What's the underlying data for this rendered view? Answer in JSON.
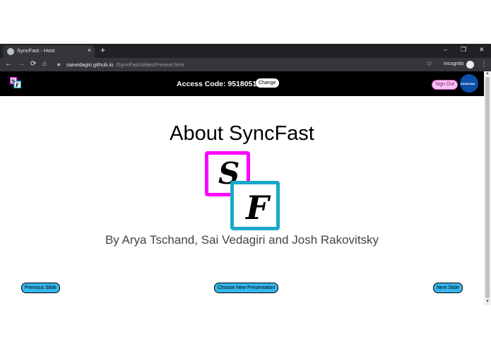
{
  "browser": {
    "tab_title": "SyncFast - Host",
    "tab_close": "×",
    "new_tab": "+",
    "window_controls": {
      "minimize": "–",
      "restore": "❐",
      "close": "✕"
    },
    "nav": {
      "back": "←",
      "forward": "→",
      "reload": "⟳",
      "home": "⌂"
    },
    "url_host": "saivedagiri.github.io",
    "url_path": "/SyncFast/slidesPresent.html",
    "star": "☆",
    "incognito_label": "Incognito",
    "menu": "⋮"
  },
  "header": {
    "access_code_label": "Access Code: 9518051",
    "change_label": "Change",
    "sign_out_label": "Sign Out",
    "avatar_text": "SAMSUNG"
  },
  "slide": {
    "title": "About SyncFast",
    "logo_letter_1": "S",
    "logo_letter_2": "F",
    "subtitle": "By Arya Tschand, Sai Vedagiri and Josh Rakovitsky"
  },
  "controls": {
    "previous_label": "Previous Slide",
    "choose_label": "Choose New Presentation",
    "next_label": "Next Slide"
  },
  "colors": {
    "logo_pink": "#ff00ff",
    "logo_cyan": "#1aa8c8",
    "button_blue": "#35b7ee",
    "header_bg": "#000000"
  }
}
